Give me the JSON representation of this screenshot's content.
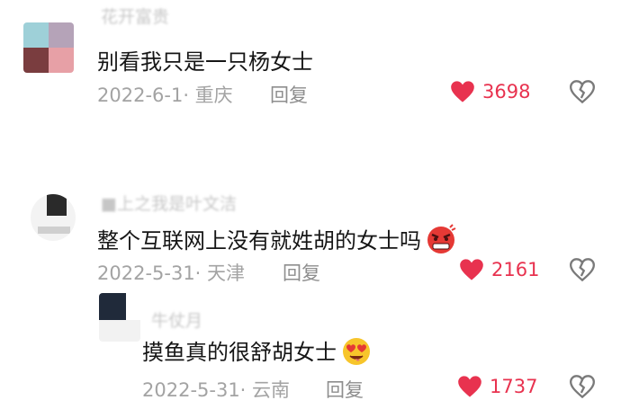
{
  "comments": [
    {
      "username": "花开富贵",
      "text": "别看我只是一只杨女士",
      "date_location": "2022-6-1· 重庆",
      "reply_label": "回复",
      "likes": "3698"
    },
    {
      "username": "■上之我是叶文洁",
      "text": "整个互联网上没有就姓胡的女士吗",
      "date_location": "2022-5-31· 天津",
      "reply_label": "回复",
      "likes": "2161"
    },
    {
      "username": "牛仗月",
      "text": "摸鱼真的很舒胡女士",
      "date_location": "2022-5-31· 云南",
      "reply_label": "回复",
      "likes": "1737"
    }
  ],
  "colors": {
    "heart": "#e8324f",
    "text": "#161616",
    "meta": "#a3a3a3"
  },
  "icons": [
    "heart-icon",
    "broken-heart-icon",
    "angry-face-emoji",
    "heart-eyes-emoji"
  ]
}
